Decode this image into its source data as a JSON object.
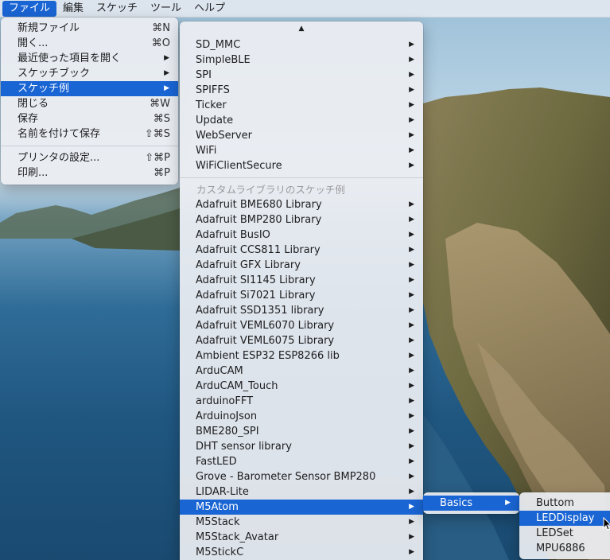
{
  "menubar": {
    "items": [
      "ファイル",
      "編集",
      "スケッチ",
      "ツール",
      "ヘルプ"
    ],
    "active_index": 0
  },
  "file_menu": {
    "groups": [
      [
        {
          "label": "新規ファイル",
          "shortcut": "⌘N"
        },
        {
          "label": "開く...",
          "shortcut": "⌘O"
        },
        {
          "label": "最近使った項目を開く",
          "submenu": true
        },
        {
          "label": "スケッチブック",
          "submenu": true
        },
        {
          "label": "スケッチ例",
          "submenu": true,
          "selected": true
        },
        {
          "label": "閉じる",
          "shortcut": "⌘W"
        },
        {
          "label": "保存",
          "shortcut": "⌘S"
        },
        {
          "label": "名前を付けて保存",
          "shortcut": "⇧⌘S"
        }
      ],
      [
        {
          "label": "プリンタの設定...",
          "shortcut": "⇧⌘P"
        },
        {
          "label": "印刷...",
          "shortcut": "⌘P"
        }
      ]
    ]
  },
  "examples_menu": {
    "scroll_up_glyph": "▲",
    "builtin_items": [
      "SD_MMC",
      "SimpleBLE",
      "SPI",
      "SPIFFS",
      "Ticker",
      "Update",
      "WebServer",
      "WiFi",
      "WiFiClientSecure"
    ],
    "custom_header": "カスタムライブラリのスケッチ例",
    "custom_items": [
      "Adafruit BME680 Library",
      "Adafruit BMP280 Library",
      "Adafruit BusIO",
      "Adafruit CCS811 Library",
      "Adafruit GFX Library",
      "Adafruit SI1145 Library",
      "Adafruit Si7021 Library",
      "Adafruit SSD1351 library",
      "Adafruit VEML6070 Library",
      "Adafruit VEML6075 Library",
      "Ambient ESP32 ESP8266 lib",
      "ArduCAM",
      "ArduCAM_Touch",
      "arduinoFFT",
      "ArduinoJson",
      "BME280_SPI",
      "DHT sensor library",
      "FastLED",
      "Grove - Barometer Sensor BMP280",
      "LIDAR-Lite",
      "M5Atom",
      "M5Stack",
      "M5Stack_Avatar",
      "M5StickC"
    ],
    "selected_item": "M5Atom"
  },
  "basics_menu": {
    "items": [
      "Basics"
    ],
    "selected_item": "Basics"
  },
  "leaf_menu": {
    "items": [
      "Buttom",
      "LEDDisplay",
      "LEDSet",
      "MPU6886"
    ],
    "selected_item": "LEDDisplay"
  },
  "colors": {
    "selection": "#1a65d4",
    "menu_bg": "#eceef2",
    "separator_text": "#9a9a9e"
  },
  "icons": {
    "submenu_arrow": "▶",
    "cursor": "arrow-cursor-icon"
  }
}
